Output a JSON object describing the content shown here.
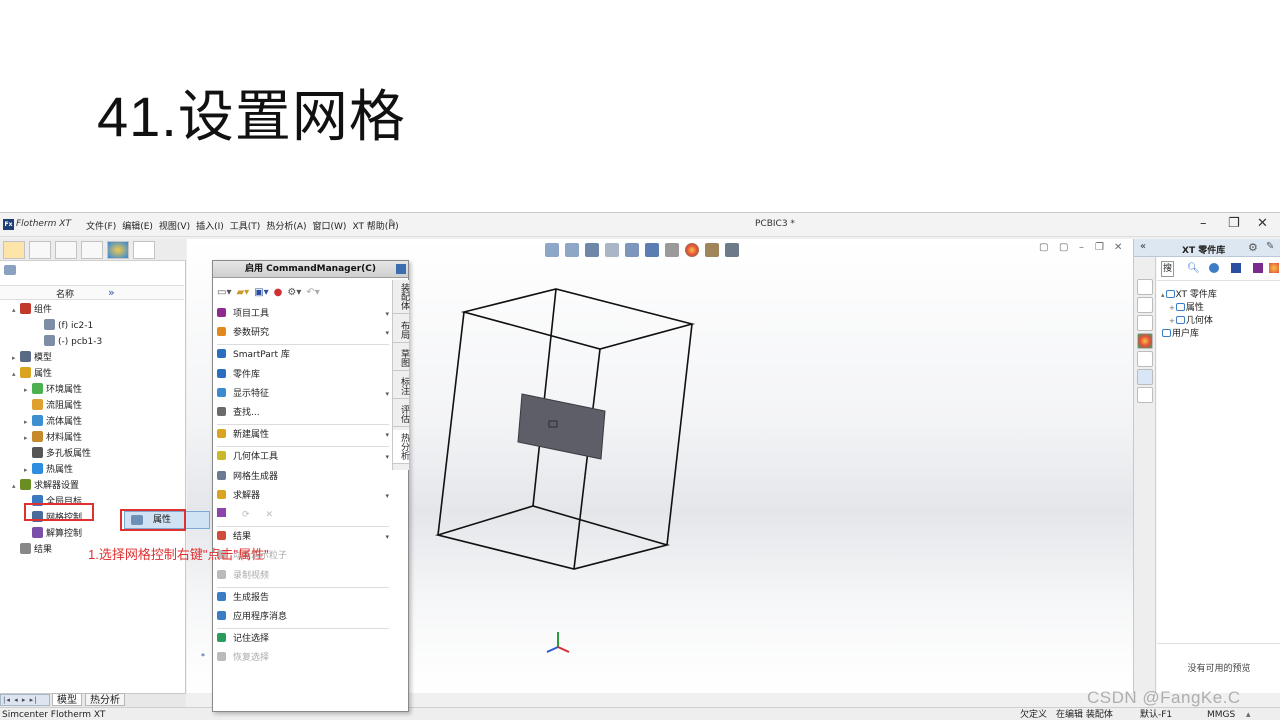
{
  "slide": {
    "title": "41.设置网格"
  },
  "app": {
    "name": "Flotherm XT",
    "menu": [
      "文件(F)",
      "编辑(E)",
      "视图(V)",
      "插入(I)",
      "工具(T)",
      "热分析(A)",
      "窗口(W)",
      "XT 帮助(H)"
    ],
    "document_title": "PCBIC3 *"
  },
  "left_panel": {
    "column_header": "名称",
    "expand_glyph": "»",
    "tree": [
      {
        "label": "组件",
        "indent": 0,
        "expander": "▴",
        "icon": "assembly-icon",
        "color": "#c0392b"
      },
      {
        "label": "(f) ic2-1",
        "indent": 2,
        "expander": "",
        "icon": "part-icon",
        "color": "#7d8da6"
      },
      {
        "label": "(-) pcb1-3",
        "indent": 2,
        "expander": "",
        "icon": "part-icon",
        "color": "#7d8da6"
      },
      {
        "label": "模型",
        "indent": 0,
        "expander": "▸",
        "icon": "model-icon",
        "color": "#5a6a84"
      },
      {
        "label": "属性",
        "indent": 0,
        "expander": "▴",
        "icon": "properties-icon",
        "color": "#d9a521"
      },
      {
        "label": "环境属性",
        "indent": 1,
        "expander": "▸",
        "icon": "environment-icon",
        "color": "#4caf50"
      },
      {
        "label": "流阻属性",
        "indent": 1,
        "expander": "",
        "icon": "flow-resistance-icon",
        "color": "#e0a030"
      },
      {
        "label": "流体属性",
        "indent": 1,
        "expander": "▸",
        "icon": "fluid-icon",
        "color": "#3d8fd1"
      },
      {
        "label": "材料属性",
        "indent": 1,
        "expander": "▸",
        "icon": "material-icon",
        "color": "#c48a2b"
      },
      {
        "label": "多孔板属性",
        "indent": 1,
        "expander": "",
        "icon": "perforated-plate-icon",
        "color": "#555555"
      },
      {
        "label": "热属性",
        "indent": 1,
        "expander": "▸",
        "icon": "thermal-icon",
        "color": "#2f8de0"
      },
      {
        "label": "求解器设置",
        "indent": 0,
        "expander": "▴",
        "icon": "solver-settings-icon",
        "color": "#6b8e23"
      },
      {
        "label": "全局目标",
        "indent": 1,
        "expander": "",
        "icon": "global-goal-icon",
        "color": "#3a78c2"
      },
      {
        "label": "网格控制",
        "indent": 1,
        "expander": "",
        "icon": "mesh-control-icon",
        "color": "#4a6a9c"
      },
      {
        "label": "解算控制",
        "indent": 1,
        "expander": "",
        "icon": "solve-control-icon",
        "color": "#7b4fa8"
      },
      {
        "label": "结果",
        "indent": 0,
        "expander": "",
        "icon": "results-icon",
        "color": "#888888"
      }
    ],
    "bottom_tabs": [
      "模型",
      "热分析"
    ]
  },
  "context_menu": {
    "properties_label": "属性"
  },
  "annotation": "1.选择网格控制右键\"点击\"属性\"",
  "command_manager": {
    "title": "启用 CommandManager(C)",
    "vertical_tabs": [
      "装配体",
      "布局",
      "草图",
      "标注",
      "评估",
      "热分析"
    ],
    "items": [
      {
        "label": "项目工具",
        "arrow": "▾",
        "icon": "project-tools-icon",
        "color": "#8e2a8e",
        "disabled": false
      },
      {
        "label": "参数研究",
        "arrow": "▾",
        "icon": "parametric-study-icon",
        "color": "#e08a1e",
        "disabled": false
      },
      {
        "label": "SmartPart 库",
        "arrow": "",
        "icon": "smartpart-library-icon",
        "color": "#2a6fbf",
        "disabled": false
      },
      {
        "label": "零件库",
        "arrow": "",
        "icon": "parts-library-icon",
        "color": "#2a6fbf",
        "disabled": false
      },
      {
        "label": "显示特征",
        "arrow": "▾",
        "icon": "display-features-icon",
        "color": "#3b8bd0",
        "disabled": false
      },
      {
        "label": "查找...",
        "arrow": "",
        "icon": "find-icon",
        "color": "#6b6b6b",
        "disabled": false
      },
      {
        "label": "新建属性",
        "arrow": "▾",
        "icon": "new-property-icon",
        "color": "#d9a521",
        "disabled": false
      },
      {
        "label": "几何体工具",
        "arrow": "▾",
        "icon": "geometry-tools-icon",
        "color": "#c9b92a",
        "disabled": false
      },
      {
        "label": "网格生成器",
        "arrow": "",
        "icon": "mesher-icon",
        "color": "#6a7a92",
        "disabled": false
      },
      {
        "label": "求解器",
        "arrow": "▾",
        "icon": "solver-icon",
        "color": "#d9a521",
        "disabled": false
      },
      {
        "label": "结果",
        "arrow": "▾",
        "icon": "results-menu-icon",
        "color": "#d14b3a",
        "disabled": false
      },
      {
        "label": "动画演示粒子",
        "arrow": "",
        "icon": "animate-particles-icon",
        "color": "#bbbbbb",
        "disabled": true
      },
      {
        "label": "录制视频",
        "arrow": "",
        "icon": "record-video-icon",
        "color": "#bbbbbb",
        "disabled": true
      },
      {
        "label": "生成报告",
        "arrow": "",
        "icon": "generate-report-icon",
        "color": "#3b7dc4",
        "disabled": false
      },
      {
        "label": "应用程序消息",
        "arrow": "",
        "icon": "app-messages-icon",
        "color": "#3b7dc4",
        "disabled": false
      },
      {
        "label": "记住选择",
        "arrow": "",
        "icon": "remember-selection-icon",
        "color": "#2a9d5c",
        "disabled": false
      },
      {
        "label": "恢复选择",
        "arrow": "",
        "icon": "restore-selection-icon",
        "color": "#bbbbbb",
        "disabled": true
      }
    ]
  },
  "right_panel": {
    "title": "XT 零件库",
    "search_tab": "搜",
    "tree": [
      {
        "label": "XT 零件库",
        "indent": 0,
        "expander": "▴"
      },
      {
        "label": "属性",
        "indent": 1,
        "expander": "+"
      },
      {
        "label": "几何体",
        "indent": 1,
        "expander": "+"
      },
      {
        "label": "用户库",
        "indent": 0,
        "expander": ""
      }
    ],
    "preview_text": "没有可用的预览"
  },
  "status_bar": {
    "app_name": "Simcenter Flotherm XT",
    "under_defined": "欠定义",
    "editing": "在编辑 装配体",
    "shortcut": "默认-F1",
    "units": "MMGS"
  },
  "watermark": "CSDN @FangKe.C"
}
